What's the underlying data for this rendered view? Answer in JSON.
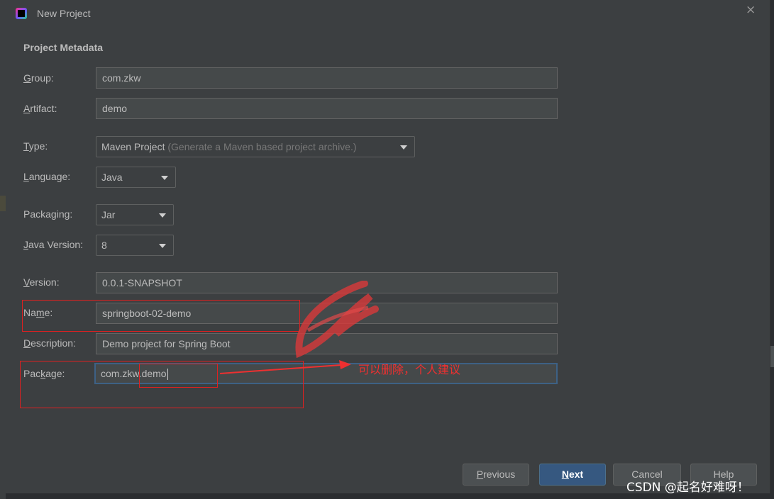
{
  "window": {
    "title": "New Project",
    "close_glyph": "×",
    "icon": "intellij-app-icon"
  },
  "form": {
    "section_title": "Project Metadata",
    "group": {
      "label_mnemonic": "G",
      "label_rest": "roup:",
      "value": "com.zkw"
    },
    "artifact": {
      "label_mnemonic": "A",
      "label_rest": "rtifact:",
      "value": "demo"
    },
    "type": {
      "label_mnemonic": "T",
      "label_rest": "ype:",
      "value": "Maven Project",
      "hint": "(Generate a Maven based project archive.)"
    },
    "language": {
      "label_mnemonic": "L",
      "label_rest": "anguage:",
      "value": "Java"
    },
    "packaging": {
      "label_pre": "Packa",
      "label_mnemonic": "g",
      "label_rest": "ing:",
      "value": "Jar"
    },
    "java_version": {
      "label_mnemonic": "J",
      "label_rest": "ava Version:",
      "value": "8"
    },
    "version": {
      "label_mnemonic": "V",
      "label_rest": "ersion:",
      "value": "0.0.1-SNAPSHOT"
    },
    "name": {
      "label_pre": "Na",
      "label_mnemonic": "m",
      "label_rest": "e:",
      "value": "springboot-02-demo"
    },
    "description": {
      "label_mnemonic": "D",
      "label_rest": "escription:",
      "value": "Demo project for Spring Boot"
    },
    "package": {
      "label_pre": "Pac",
      "label_mnemonic": "k",
      "label_rest": "age:",
      "value": "com.zkw.demo"
    }
  },
  "annotation": {
    "text": "可以删除，个人建议",
    "color": "#ee3030"
  },
  "buttons": {
    "previous": {
      "mnemonic": "P",
      "rest": "revious"
    },
    "next": {
      "mnemonic": "N",
      "rest": "ext"
    },
    "cancel": {
      "label": "Cancel"
    },
    "help": {
      "label": "Help"
    }
  },
  "watermark": "CSDN @起名好难呀！",
  "colors": {
    "accent_button": "#365880",
    "focus_border": "#3d6185",
    "dialog_bg": "#3c3f41",
    "field_bg": "#45494a"
  }
}
